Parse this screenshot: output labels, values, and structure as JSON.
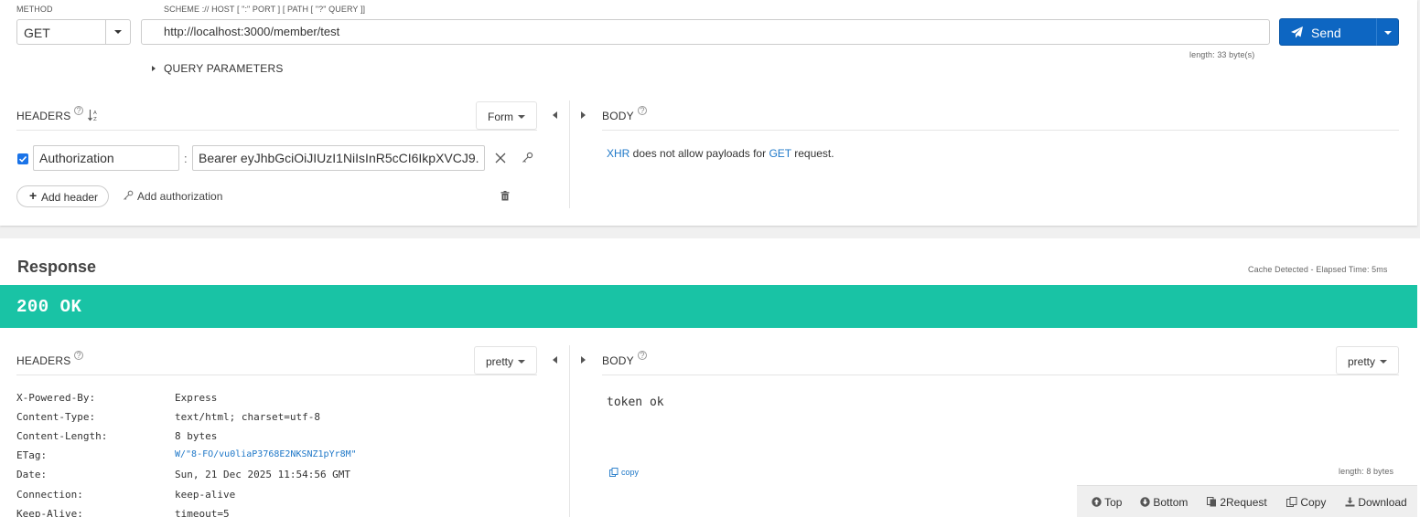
{
  "request": {
    "method_label": "METHOD",
    "method_value": "GET",
    "url_label": "SCHEME :// HOST [ \":\" PORT ] [ PATH [ \"?\" QUERY ]]",
    "url_value": "http://localhost:3000/member/test",
    "send_label": "Send",
    "url_length": "length: 33 byte(s)",
    "query_params_label": "QUERY PARAMETERS",
    "headers": {
      "title": "HEADERS",
      "help": "?",
      "sort_icon": "↓A Z",
      "mode": "Form",
      "rows": [
        {
          "enabled": true,
          "name": "Authorization",
          "value": "Bearer eyJhbGciOiJIUzI1NiIsInR5cCI6IkpXVCJ9."
        }
      ],
      "add_header_label": "Add header",
      "add_authorization_label": "Add authorization"
    },
    "body": {
      "title": "BODY",
      "help": "?",
      "notice_link1": "XHR",
      "notice_mid": " does not allow payloads for ",
      "notice_link2": "GET",
      "notice_end": " request."
    }
  },
  "response": {
    "title": "Response",
    "meta": "Cache Detected - Elapsed Time: 5ms",
    "status": "200 OK",
    "status_color": "#19c3a5",
    "headers": {
      "title": "HEADERS",
      "help": "?",
      "mode": "pretty",
      "rows": [
        {
          "name": "X-Powered-By:",
          "value": "Express",
          "link": false
        },
        {
          "name": "Content-Type:",
          "value": "text/html; charset=utf-8",
          "link": false
        },
        {
          "name": "Content-Length:",
          "value": "8 bytes",
          "link": false
        },
        {
          "name": "ETag:",
          "value": "W/\"8-FO/vu0liaP3768E2NKSNZ1pYr8M\"",
          "link": true
        },
        {
          "name": "Date:",
          "value": "Sun, 21 Dec 2025 11:54:56 GMT",
          "link": false
        },
        {
          "name": "Connection:",
          "value": "keep-alive",
          "link": false
        },
        {
          "name": "Keep-Alive:",
          "value": "timeout=5",
          "link": false
        }
      ]
    },
    "body": {
      "title": "BODY",
      "help": "?",
      "mode": "pretty",
      "content": "token ok",
      "copy_label": "copy",
      "length": "length: 8 bytes"
    }
  },
  "bottom_bar": {
    "top": "Top",
    "bottom": "Bottom",
    "to_request": "2Request",
    "copy": "Copy",
    "download": "Download"
  },
  "colors": {
    "accent": "#0d66c2",
    "link": "#1f78c8",
    "checkbox": "#1a73e8"
  }
}
